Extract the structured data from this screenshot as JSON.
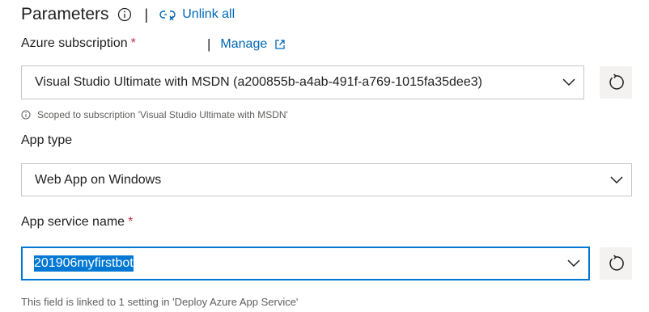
{
  "header": {
    "title": "Parameters",
    "separator": "|",
    "unlink_label": "Unlink all"
  },
  "subscription": {
    "label": "Azure subscription",
    "required_mark": "*",
    "manage_separator": "|",
    "manage_label": "Manage",
    "value": "Visual Studio Ultimate with MSDN (a200855b-a4ab-491f-a769-1015fa35dee3)",
    "hint": "Scoped to subscription 'Visual Studio Ultimate with MSDN'"
  },
  "app_type": {
    "label": "App type",
    "value": "Web App on Windows"
  },
  "app_service": {
    "label": "App service name",
    "required_mark": "*",
    "value": "201906myfirstbot",
    "helper": "This field is linked to 1 setting in 'Deploy Azure App Service'"
  },
  "colors": {
    "link": "#0067b8",
    "focus": "#0078d4",
    "required": "#c4314b"
  }
}
